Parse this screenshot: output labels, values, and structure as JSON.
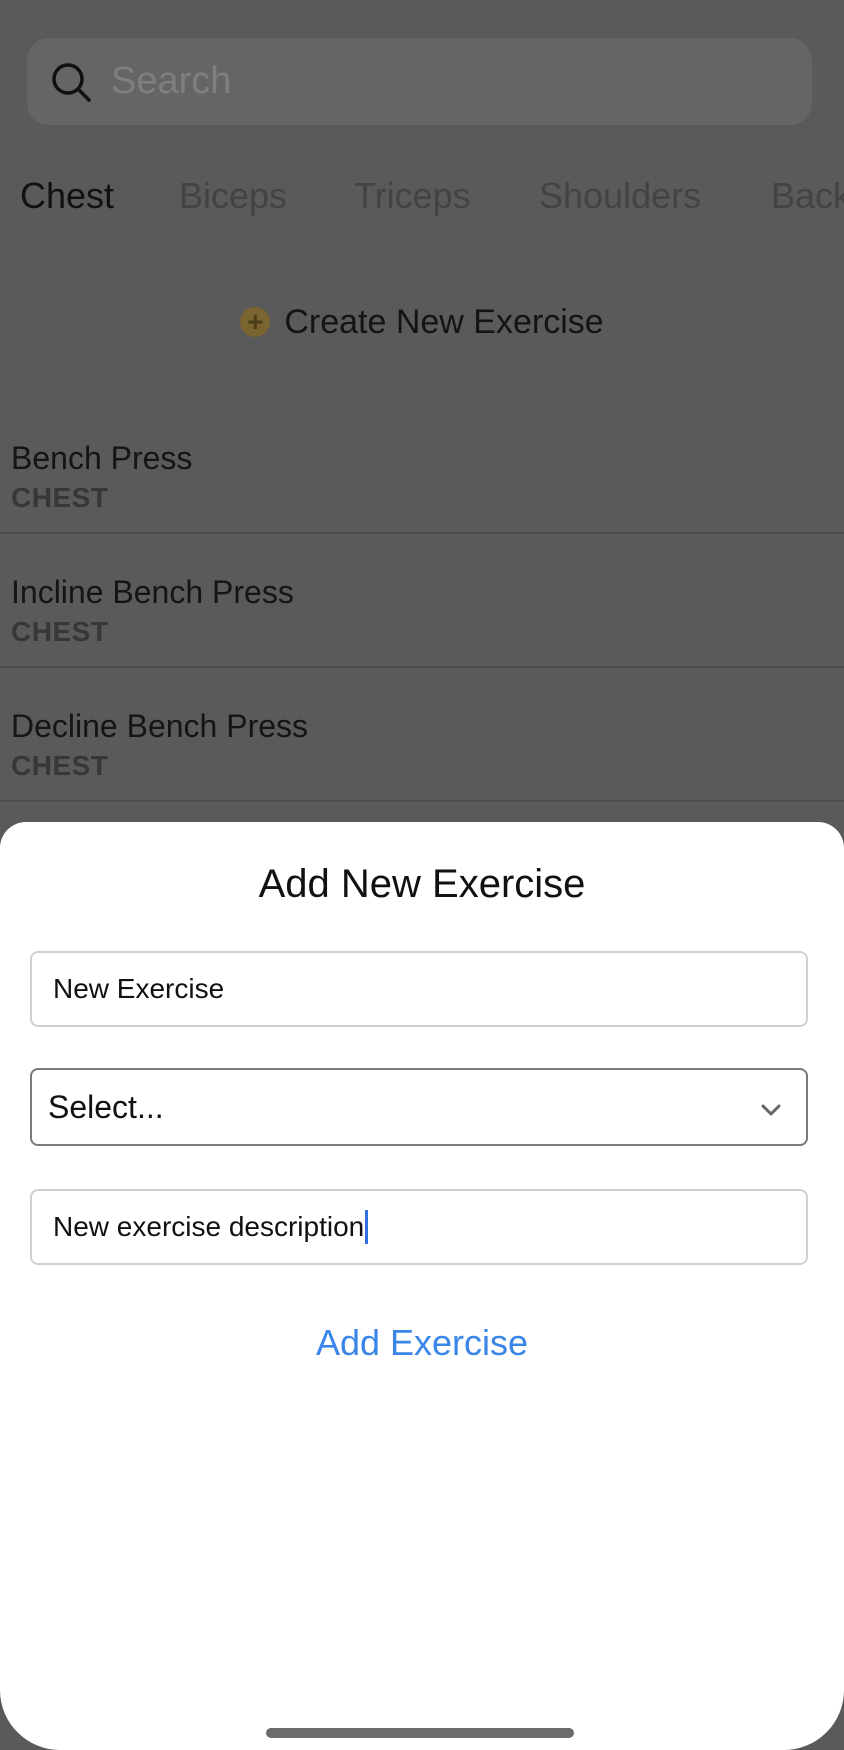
{
  "search": {
    "placeholder": "Search"
  },
  "tabs": [
    {
      "label": "Chest",
      "active": true
    },
    {
      "label": "Biceps",
      "active": false
    },
    {
      "label": "Triceps",
      "active": false
    },
    {
      "label": "Shoulders",
      "active": false
    },
    {
      "label": "Back",
      "active": false
    }
  ],
  "create_new": {
    "label": "Create New Exercise",
    "icon": "plus-circle-icon",
    "icon_color": "#c9a035"
  },
  "exercises": [
    {
      "name": "Bench Press",
      "category": "CHEST"
    },
    {
      "name": "Incline Bench Press",
      "category": "CHEST"
    },
    {
      "name": "Decline Bench Press",
      "category": "CHEST"
    }
  ],
  "modal": {
    "title": "Add New Exercise",
    "name_value": "New Exercise",
    "select_value": "Select...",
    "description_value": "New exercise description",
    "submit_label": "Add Exercise",
    "accent_color": "#3a86e8"
  }
}
